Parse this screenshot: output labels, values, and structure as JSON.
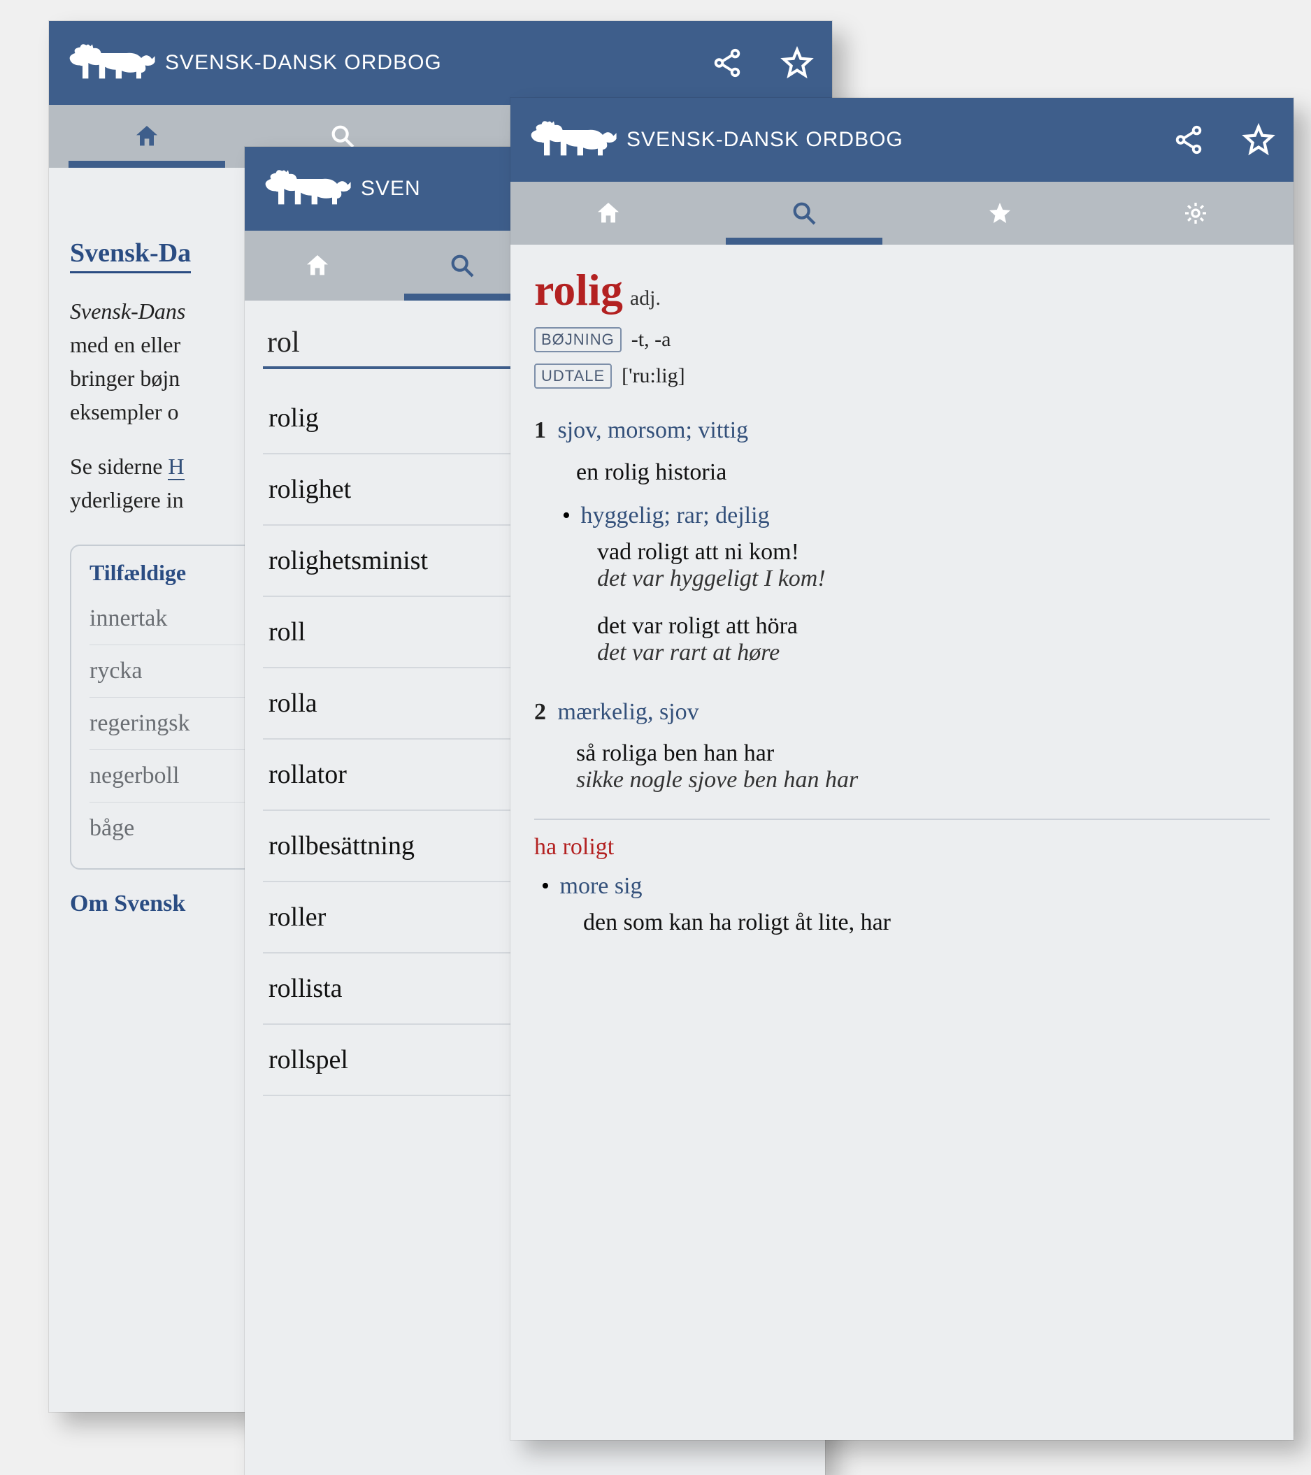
{
  "app": {
    "title": "SVENSK-DANSK ORDBOG"
  },
  "screen_home": {
    "heading": "Svensk-Da",
    "para_line1": "Svensk-Dans",
    "para_line2": "med en eller",
    "para_line3": "bringer bøjn",
    "para_line4": "eksempler o",
    "para2_a": "Se siderne ",
    "para2_link": "H",
    "para2_b": "yderligere in",
    "random_heading": "Tilfældige",
    "random_items": [
      "innertak",
      "rycka",
      "regeringsk",
      "negerboll",
      "båge"
    ],
    "about_heading": "Om Svensk"
  },
  "screen_search": {
    "query": "rol",
    "suggestions": [
      "rolig",
      "rolighet",
      "rolighetsminist",
      "roll",
      "rolla",
      "rollator",
      "rollbesättning",
      "roller",
      "rollista",
      "rollspel"
    ]
  },
  "screen_entry": {
    "headword": "rolig",
    "pos": "adj.",
    "tag_bojning_label": "BØJNING",
    "tag_bojning_val": "-t, -a",
    "tag_udtale_label": "UDTALE",
    "tag_udtale_val": "['ru:lig]",
    "sense1_num": "1",
    "sense1_links": [
      "sjov",
      "morsom",
      "vittig"
    ],
    "sense1_ex1": "en rolig historia",
    "sense1_sub_links": [
      "hyggelig",
      "rar",
      "dejlig"
    ],
    "sense1_sub_ex1_sv": "vad roligt att ni kom!",
    "sense1_sub_ex1_da": "det var hyggeligt I kom!",
    "sense1_sub_ex2_sv": "det var roligt att höra",
    "sense1_sub_ex2_da": "det var rart at høre",
    "sense2_num": "2",
    "sense2_links": [
      "mærkelig",
      "sjov"
    ],
    "sense2_ex1_sv": "så roliga ben han har",
    "sense2_ex1_da": "sikke nogle sjove ben han har",
    "phrase_head": "ha roligt",
    "phrase_sub_link": "more sig",
    "phrase_ex_sv": "den som kan ha roligt åt lite, har"
  }
}
